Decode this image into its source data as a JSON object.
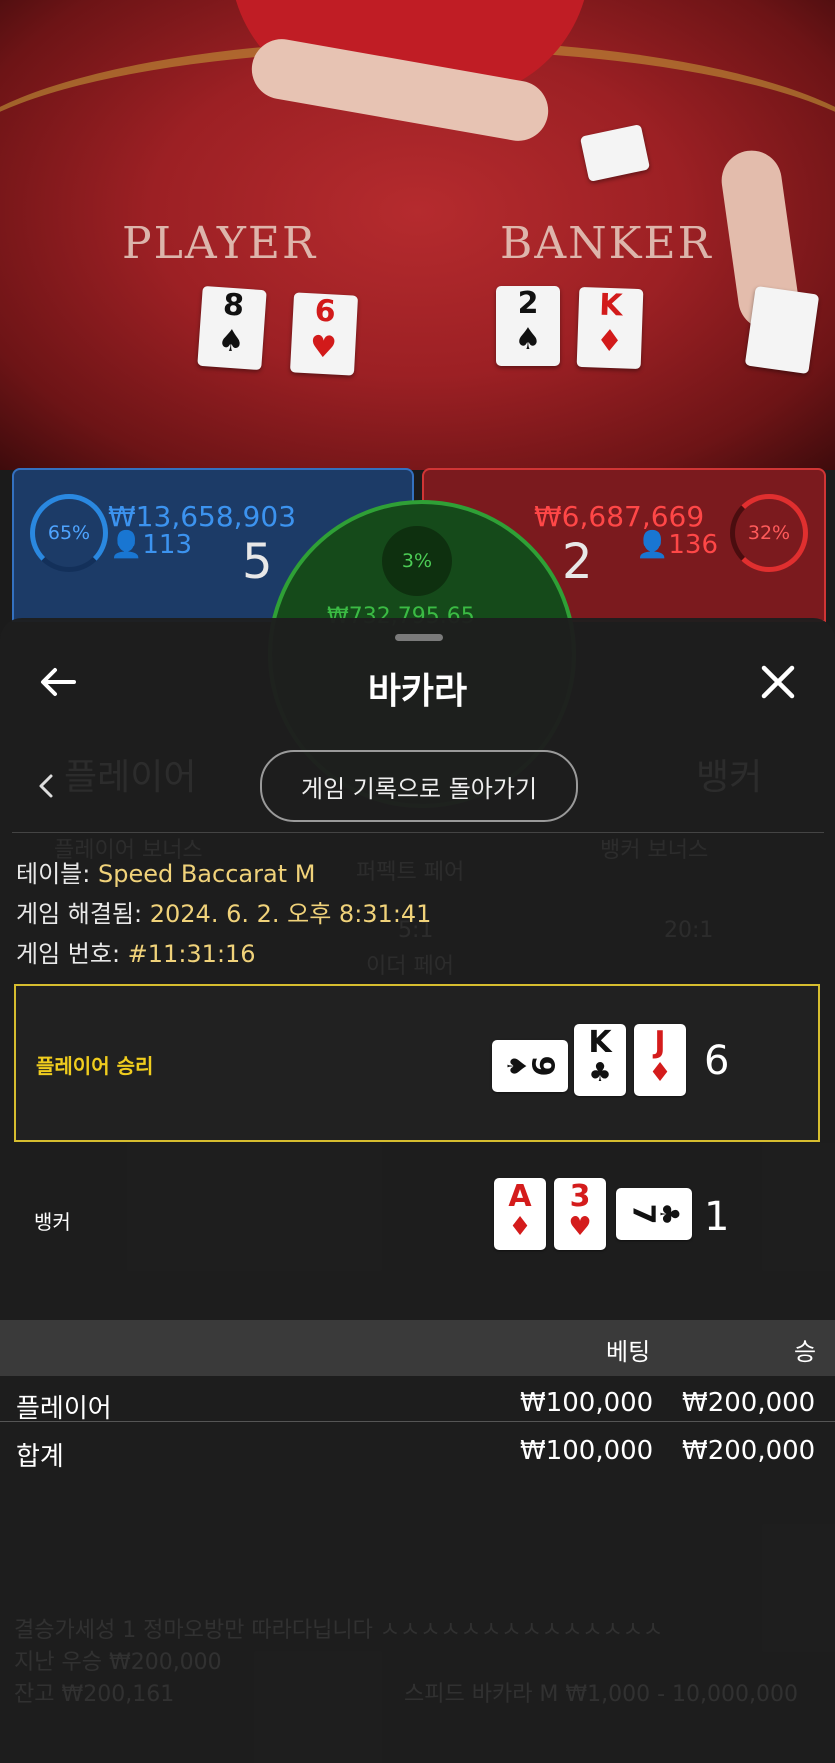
{
  "table_view": {
    "player_label": "PLAYER",
    "banker_label": "BANKER",
    "player_cards": [
      {
        "rank": "8",
        "suit": "♠",
        "color": "black"
      },
      {
        "rank": "6",
        "suit": "♥",
        "color": "red"
      }
    ],
    "banker_cards": [
      {
        "rank": "2",
        "suit": "♠",
        "color": "black"
      },
      {
        "rank": "K",
        "suit": "♦",
        "color": "red"
      }
    ]
  },
  "stats": {
    "player_percent": "65%",
    "player_amount": "₩13,658,903",
    "player_bettors": "113",
    "player_score": "5",
    "banker_percent": "32%",
    "banker_amount": "₩6,687,669",
    "banker_bettors": "136",
    "banker_score": "2",
    "tie_percent": "3%",
    "tie_amount": "₩732,795.65"
  },
  "sheet": {
    "title": "바카라",
    "back_to_history": "게임 기록으로 돌아가기",
    "table_label": "테이블: ",
    "table_value": "Speed Baccarat M",
    "resolved_label": "게임 해결됨: ",
    "resolved_value": "2024. 6. 2. 오후 8:31:41",
    "game_no_label": "게임 번호: ",
    "game_no_value": "#11:31:16",
    "player_hand": {
      "label": "플레이어 승리",
      "total": "6",
      "cards": [
        {
          "rank": "9",
          "suit": "♠",
          "color": "black"
        },
        {
          "rank": "K",
          "suit": "♣",
          "color": "black"
        },
        {
          "rank": "J",
          "suit": "♦",
          "color": "red"
        }
      ]
    },
    "banker_hand": {
      "label": "뱅커",
      "total": "1",
      "cards": [
        {
          "rank": "A",
          "suit": "♦",
          "color": "red"
        },
        {
          "rank": "3",
          "suit": "♥",
          "color": "red"
        },
        {
          "rank": "7",
          "suit": "♣",
          "color": "black"
        }
      ]
    },
    "bets_table": {
      "headers": {
        "bet": "베팅",
        "win": "승"
      },
      "rows": [
        {
          "name": "플레이어",
          "bet": "₩100,000",
          "win": "₩200,000"
        },
        {
          "name": "합계",
          "bet": "₩100,000",
          "win": "₩200,000"
        }
      ]
    }
  },
  "background_ghost": {
    "player": "플레이어",
    "banker": "뱅커",
    "player_bonus": "플레이어 보너스",
    "banker_bonus": "뱅커 보너스",
    "perfect_pair": "퍼펙트 페어",
    "either_pair": "이더 페어",
    "either_odds": "5:1",
    "banker_bonus_odds": "20:1",
    "footer_line1": "결승가세성 1 정마오방만 따라다닙니다 ㅅㅅㅅㅅㅅㅅㅅㅅㅅㅅㅅㅅㅅㅅ",
    "footer_line2": "지난 우승 ₩200,000",
    "footer_line3": "잔고 ₩200,161",
    "footer_limits": "스피드 바카라 M ₩1,000 - 10,000,000"
  },
  "colors": {
    "win_highlight": "#d6bd2f",
    "player_blue": "#2a88e0",
    "banker_red": "#e02f2f",
    "tie_green": "#2fa036"
  }
}
